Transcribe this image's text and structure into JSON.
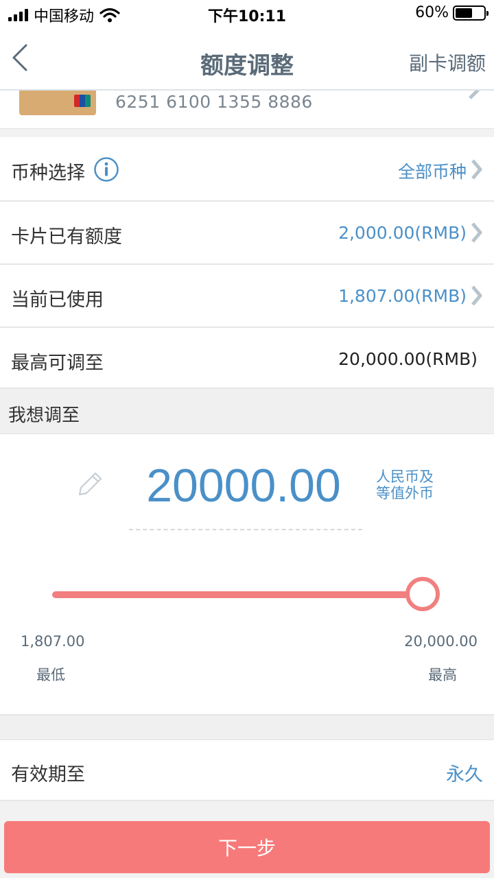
{
  "status_bar": {
    "carrier": "中国移动",
    "time": "下午10:11",
    "battery": "60%",
    "battery_level": 0.6
  },
  "nav": {
    "title": "额度调整",
    "right_action": "副卡调额"
  },
  "card": {
    "number": "6251 6100 1355 8886"
  },
  "rows": {
    "currency": {
      "label": "币种选择",
      "value": "全部币种"
    },
    "existing_limit": {
      "label": "卡片已有额度",
      "value": "2,000.00(RMB)"
    },
    "used": {
      "label": "当前已使用",
      "value": "1,807.00(RMB)"
    },
    "max_adjust": {
      "label": "最高可调至",
      "value": "20,000.00(RMB)"
    }
  },
  "section": {
    "want_label": "我想调至"
  },
  "adjust": {
    "amount": "20000.00",
    "currency_line1": "人民币及",
    "currency_line2": "等值外币",
    "slider": {
      "min_value": "1,807.00",
      "max_value": "20,000.00",
      "min_label": "最低",
      "max_label": "最高",
      "position": 1.0
    }
  },
  "validity": {
    "label": "有效期至",
    "value": "永久"
  },
  "next_button": "下一步",
  "colors": {
    "accent_blue": "#4a90c8",
    "slider_red": "#f27f7f",
    "button_red": "#f77a7a",
    "title_gray": "#5a6a78"
  }
}
